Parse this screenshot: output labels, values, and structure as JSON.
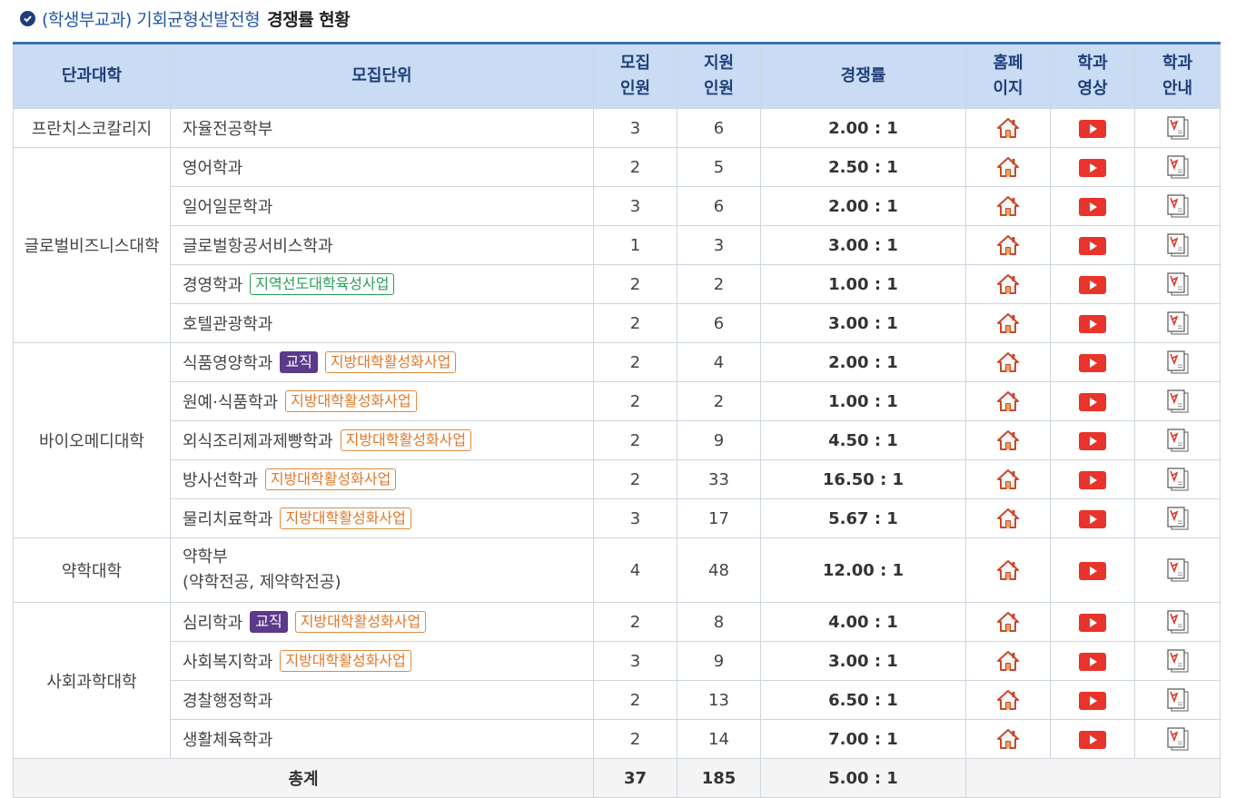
{
  "title": {
    "part1": "(학생부교과) 기회균형선발전형",
    "part2": "경쟁률 현황"
  },
  "colors": {
    "header_bg": "#c9dcf4",
    "accent": "#3d6fb6",
    "youtube": "#e8342a",
    "pdf": "#d93a2b",
    "home": "#c8482c"
  },
  "headers": {
    "college": "단과대학",
    "unit": "모집단위",
    "quota_1": "모집",
    "quota_2": "인원",
    "applicants_1": "지원",
    "applicants_2": "인원",
    "rate": "경쟁률",
    "home_1": "홈페",
    "home_2": "이지",
    "video_1": "학과",
    "video_2": "영상",
    "guide_1": "학과",
    "guide_2": "안내"
  },
  "colleges": [
    "프란치스코칼리지",
    "글로벌비즈니스대학",
    "바이오메디대학",
    "약학대학",
    "사회과학대학"
  ],
  "rows": [
    {
      "unit": "자율전공학부",
      "quota": "3",
      "applicants": "6",
      "rate": "2.00 : 1"
    },
    {
      "unit": "영어학과",
      "quota": "2",
      "applicants": "5",
      "rate": "2.50 : 1"
    },
    {
      "unit": "일어일문학과",
      "quota": "3",
      "applicants": "6",
      "rate": "2.00 : 1"
    },
    {
      "unit": "글로벌항공서비스학과",
      "quota": "1",
      "applicants": "3",
      "rate": "3.00 : 1"
    },
    {
      "unit": "경영학과",
      "badge": "지역선도대학육성사업",
      "quota": "2",
      "applicants": "2",
      "rate": "1.00 : 1"
    },
    {
      "unit": "호텔관광학과",
      "quota": "2",
      "applicants": "6",
      "rate": "3.00 : 1"
    },
    {
      "unit": "식품영양학과",
      "tag": "교직",
      "badge": "지방대학활성화사업",
      "quota": "2",
      "applicants": "4",
      "rate": "2.00 : 1"
    },
    {
      "unit": "원예·식품학과",
      "badge": "지방대학활성화사업",
      "quota": "2",
      "applicants": "2",
      "rate": "1.00 : 1"
    },
    {
      "unit": "외식조리제과제빵학과",
      "badge": "지방대학활성화사업",
      "quota": "2",
      "applicants": "9",
      "rate": "4.50 : 1"
    },
    {
      "unit": "방사선학과",
      "badge": "지방대학활성화사업",
      "quota": "2",
      "applicants": "33",
      "rate": "16.50 : 1"
    },
    {
      "unit": "물리치료학과",
      "badge": "지방대학활성화사업",
      "quota": "3",
      "applicants": "17",
      "rate": "5.67 : 1"
    },
    {
      "unit": "약학부",
      "unit2": "(약학전공, 제약학전공)",
      "quota": "4",
      "applicants": "48",
      "rate": "12.00 : 1"
    },
    {
      "unit": "심리학과",
      "tag": "교직",
      "badge": "지방대학활성화사업",
      "quota": "2",
      "applicants": "8",
      "rate": "4.00 : 1"
    },
    {
      "unit": "사회복지학과",
      "badge": "지방대학활성화사업",
      "quota": "3",
      "applicants": "9",
      "rate": "3.00 : 1"
    },
    {
      "unit": "경찰행정학과",
      "quota": "2",
      "applicants": "13",
      "rate": "6.50 : 1"
    },
    {
      "unit": "생활체육학과",
      "quota": "2",
      "applicants": "14",
      "rate": "7.00 : 1"
    }
  ],
  "total": {
    "label": "총계",
    "quota": "37",
    "applicants": "185",
    "rate": "5.00 : 1"
  }
}
